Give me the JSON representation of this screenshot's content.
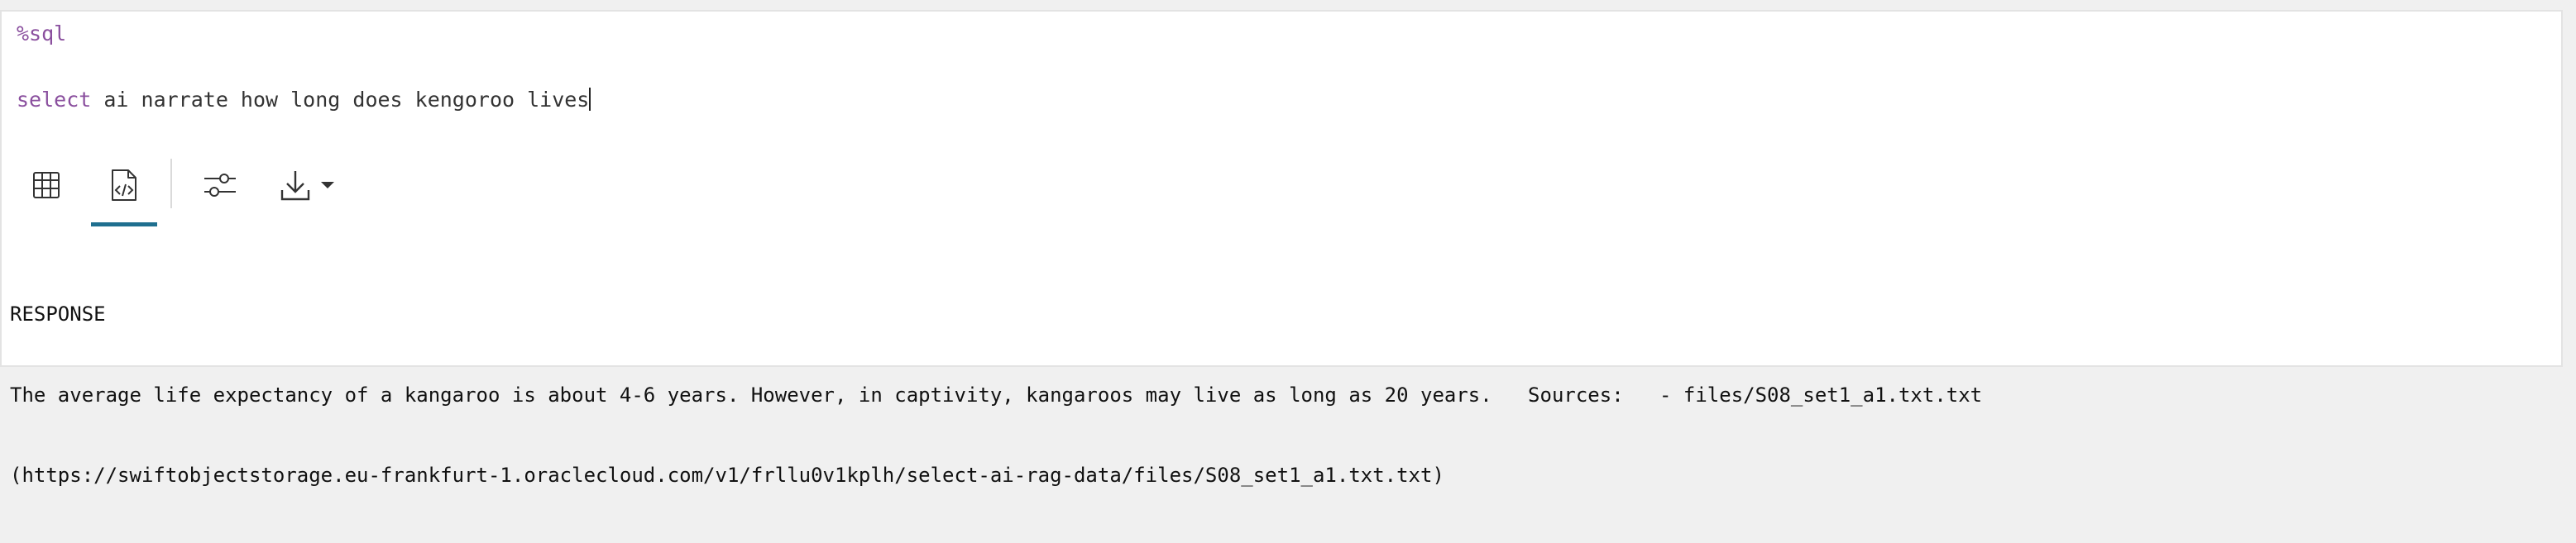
{
  "editor": {
    "magic": "%sql",
    "query_keyword": "select",
    "query_rest": " ai narrate how long does kengoroo lives"
  },
  "toolbar": {
    "items": [
      {
        "name": "table-view",
        "icon": "table-grid-icon",
        "active": false
      },
      {
        "name": "code-view",
        "icon": "code-file-icon",
        "active": true
      },
      {
        "name": "settings",
        "icon": "sliders-icon",
        "active": false
      },
      {
        "name": "download",
        "icon": "download-icon",
        "active": false
      }
    ],
    "active_color": "#1f6f8f"
  },
  "output": {
    "header": "RESPONSE",
    "line1": "The average life expectancy of a kangaroo is about 4-6 years. However, in captivity, kangaroos may live as long as 20 years.   Sources:   - files/S08_set1_a1.txt.txt",
    "line2": "(https://swiftobjectstorage.eu-frankfurt-1.oraclecloud.com/v1/frllu0v1kplh/select-ai-rag-data/files/S08_set1_a1.txt.txt)"
  }
}
